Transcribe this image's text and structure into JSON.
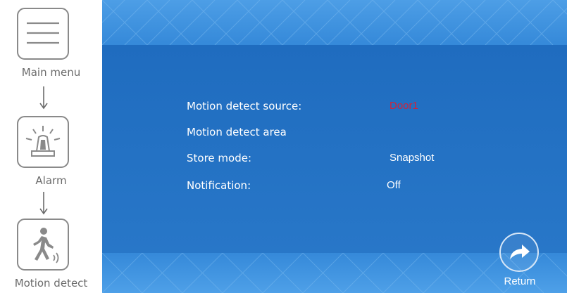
{
  "nav": {
    "items": [
      {
        "label": "Main menu",
        "icon": "hamburger-icon"
      },
      {
        "label": "Alarm",
        "icon": "siren-icon"
      },
      {
        "label": "Motion detect",
        "icon": "walking-person-icon"
      }
    ]
  },
  "settings": {
    "rows": [
      {
        "label": "Motion detect source:",
        "value": "Door1"
      },
      {
        "label": "Motion detect area",
        "value": ""
      },
      {
        "label": "Store mode:",
        "value": "Snapshot"
      },
      {
        "label": "Notification:",
        "value": "Off"
      }
    ]
  },
  "footer": {
    "return_label": "Return"
  },
  "colors": {
    "panel_blue": "#2272c4",
    "band_blue": "#4d9ee6",
    "accent_red": "#d0243a",
    "text_white": "#ffffff",
    "nav_grey": "#8a8a8a"
  }
}
